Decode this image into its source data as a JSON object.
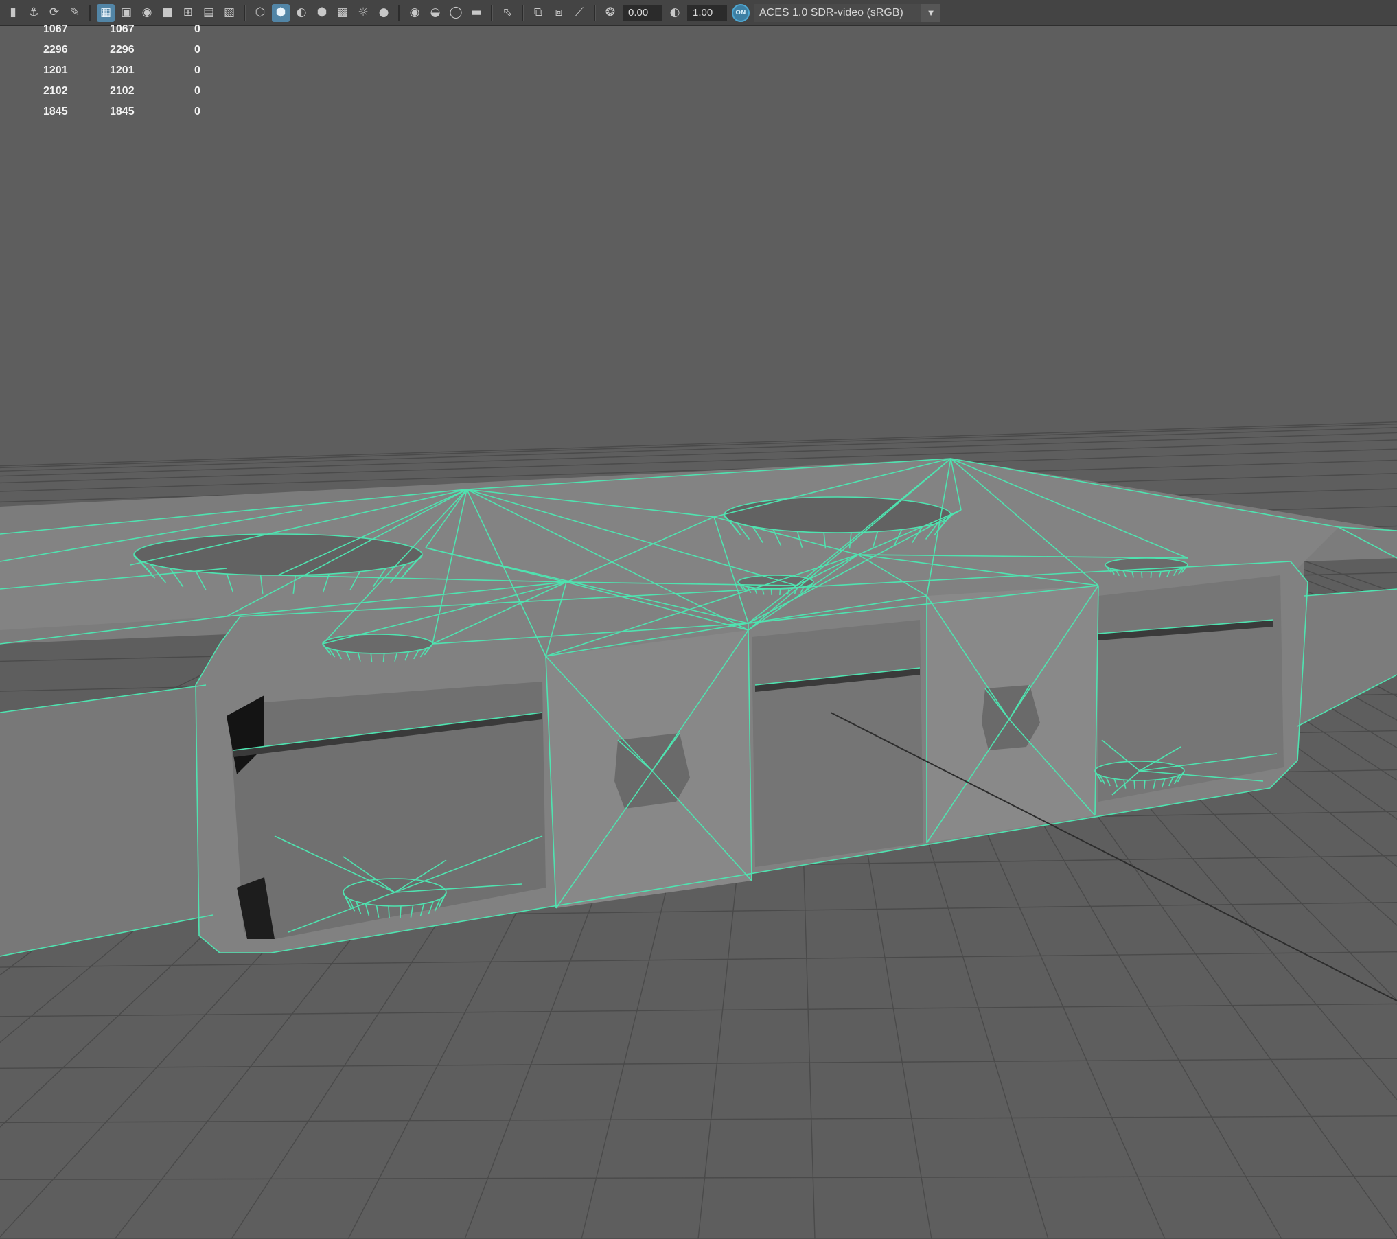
{
  "toolbar": {
    "icons": [
      "bookmark-icon",
      "snap-icon",
      "camera-move-icon",
      "paint-icon",
      "grid-icon",
      "film-gate-icon",
      "resolution-gate-icon",
      "gate-mask-icon",
      "field-chart-icon",
      "safe-action-icon",
      "safe-title-icon",
      "wireframe-icon",
      "smooth-shade-icon",
      "default-material-icon",
      "shaded-cube-icon",
      "checker-icon",
      "lights-icon",
      "shadows-icon",
      "ambient-occlusion-icon",
      "motion-blur-icon",
      "anti-alias-icon",
      "depth-of-field-icon",
      "isolate-select-icon",
      "xray-icon",
      "xray-joints-icon",
      "xray-components-icon",
      "exposure-icon",
      "gamma-icon",
      "color-management-icon"
    ],
    "exposure_value": "0.00",
    "gamma_value": "1.00",
    "color_management_toggle": "ON",
    "color_space": "ACES 1.0 SDR-video (sRGB)"
  },
  "hud": {
    "rows": [
      {
        "a": "1067",
        "b": "1067",
        "c": "0"
      },
      {
        "a": "2296",
        "b": "2296",
        "c": "0"
      },
      {
        "a": "1201",
        "b": "1201",
        "c": "0"
      },
      {
        "a": "2102",
        "b": "2102",
        "c": "0"
      },
      {
        "a": "1845",
        "b": "1845",
        "c": "0"
      }
    ]
  },
  "colors": {
    "viewport_bg": "#5e5e5e",
    "wireframe": "#4fe3b0",
    "mesh_light": "#8a8a8a",
    "mesh_mid": "#6e6e6e",
    "mesh_dark": "#3a3a3a",
    "grid_line": "#484848"
  }
}
